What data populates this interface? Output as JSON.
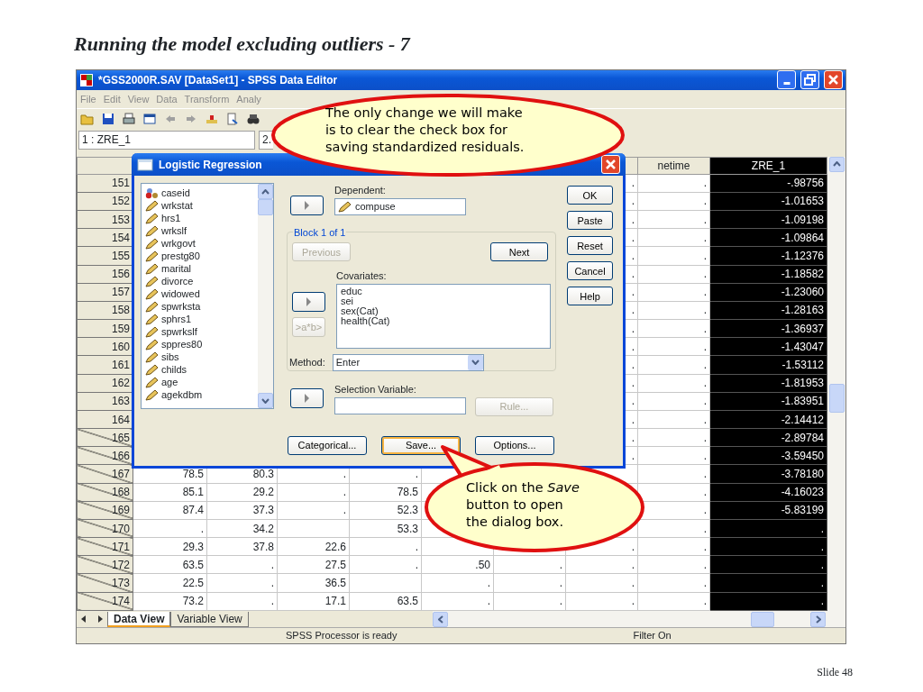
{
  "slide": {
    "title": "Running the model excluding outliers - 7",
    "number": "Slide 48"
  },
  "window": {
    "title": "*GSS2000R.SAV [DataSet1] - SPSS Data Editor"
  },
  "menu": [
    "File",
    "Edit",
    "View",
    "Data",
    "Transform",
    "Analy"
  ],
  "cell_editor": {
    "cell": "1 : ZRE_1",
    "value": "2."
  },
  "grid": {
    "columns": [
      null,
      null,
      null,
      null,
      null,
      null,
      null,
      {
        "name": "netime",
        "selected": false
      },
      {
        "name": "ZRE_1",
        "selected": true
      }
    ],
    "rows": [
      {
        "number": "151",
        "filtered": false,
        "cells": [
          null,
          null,
          null,
          null,
          null,
          null,
          ".",
          ".",
          "-.98756"
        ]
      },
      {
        "number": "152",
        "filtered": false,
        "cells": [
          null,
          null,
          null,
          null,
          null,
          null,
          ".",
          ".",
          "-1.01653"
        ]
      },
      {
        "number": "153",
        "filtered": false,
        "cells": [
          null,
          null,
          null,
          null,
          null,
          null,
          ".",
          ".",
          "-1.09198"
        ]
      },
      {
        "number": "154",
        "filtered": false,
        "cells": [
          null,
          null,
          null,
          null,
          null,
          null,
          ".",
          ".",
          "-1.09864"
        ]
      },
      {
        "number": "155",
        "filtered": false,
        "cells": [
          null,
          null,
          null,
          null,
          null,
          null,
          ".",
          ".",
          "-1.12376"
        ]
      },
      {
        "number": "156",
        "filtered": false,
        "cells": [
          null,
          null,
          null,
          null,
          null,
          null,
          ".",
          ".",
          "-1.18582"
        ]
      },
      {
        "number": "157",
        "filtered": false,
        "cells": [
          null,
          null,
          null,
          null,
          null,
          null,
          ".",
          ".",
          "-1.23060"
        ]
      },
      {
        "number": "158",
        "filtered": false,
        "cells": [
          null,
          null,
          null,
          null,
          null,
          null,
          ".",
          ".",
          "-1.28163"
        ]
      },
      {
        "number": "159",
        "filtered": false,
        "cells": [
          null,
          null,
          null,
          null,
          null,
          null,
          ".",
          ".",
          "-1.36937"
        ]
      },
      {
        "number": "160",
        "filtered": false,
        "cells": [
          null,
          null,
          null,
          null,
          null,
          null,
          ".",
          ".",
          "-1.43047"
        ]
      },
      {
        "number": "161",
        "filtered": false,
        "cells": [
          null,
          null,
          null,
          null,
          null,
          null,
          ".",
          ".",
          "-1.53112"
        ]
      },
      {
        "number": "162",
        "filtered": false,
        "cells": [
          null,
          null,
          null,
          null,
          null,
          null,
          ".",
          ".",
          "-1.81953"
        ]
      },
      {
        "number": "163",
        "filtered": false,
        "cells": [
          null,
          null,
          null,
          null,
          null,
          null,
          ".",
          ".",
          "-1.83951"
        ]
      },
      {
        "number": "164",
        "filtered": false,
        "cells": [
          null,
          null,
          null,
          null,
          null,
          null,
          ".",
          ".",
          "-2.14412"
        ]
      },
      {
        "number": "165",
        "filtered": true,
        "cells": [
          null,
          null,
          null,
          null,
          null,
          null,
          ".",
          ".",
          "-2.89784"
        ]
      },
      {
        "number": "166",
        "filtered": true,
        "cells": [
          null,
          null,
          null,
          null,
          null,
          null,
          ".",
          ".",
          "-3.59450"
        ]
      },
      {
        "number": "167",
        "filtered": true,
        "cells": [
          "78.5",
          "80.3",
          ".",
          ".",
          null,
          null,
          null,
          ".",
          "-3.78180"
        ]
      },
      {
        "number": "168",
        "filtered": true,
        "cells": [
          "85.1",
          "29.2",
          ".",
          "78.5",
          null,
          null,
          null,
          ".",
          "-4.16023"
        ]
      },
      {
        "number": "169",
        "filtered": true,
        "cells": [
          "87.4",
          "37.3",
          ".",
          "52.3",
          null,
          null,
          null,
          ".",
          "-5.83199"
        ]
      },
      {
        "number": "170",
        "filtered": true,
        "cells": [
          ".",
          "34.2",
          null,
          "53.3",
          null,
          null,
          null,
          ".",
          "."
        ]
      },
      {
        "number": "171",
        "filtered": true,
        "cells": [
          "29.3",
          "37.8",
          "22.6",
          ".",
          null,
          null,
          ".",
          ".",
          "."
        ]
      },
      {
        "number": "172",
        "filtered": true,
        "cells": [
          "63.5",
          ".",
          "27.5",
          ".",
          ".50",
          ".",
          ".",
          ".",
          "."
        ]
      },
      {
        "number": "173",
        "filtered": true,
        "cells": [
          "22.5",
          ".",
          "36.5",
          null,
          ".",
          ".",
          ".",
          ".",
          "."
        ]
      },
      {
        "number": "174",
        "filtered": true,
        "cells": [
          "73.2",
          ".",
          "17.1",
          "63.5",
          ".",
          ".",
          ".",
          ".",
          "."
        ]
      }
    ]
  },
  "dialog": {
    "title": "Logistic Regression",
    "variables": [
      {
        "name": "caseid",
        "kind": "nominal"
      },
      {
        "name": "wrkstat",
        "kind": "scale"
      },
      {
        "name": "hrs1",
        "kind": "scale"
      },
      {
        "name": "wrkslf",
        "kind": "scale"
      },
      {
        "name": "wrkgovt",
        "kind": "scale"
      },
      {
        "name": "prestg80",
        "kind": "scale"
      },
      {
        "name": "marital",
        "kind": "scale"
      },
      {
        "name": "divorce",
        "kind": "scale"
      },
      {
        "name": "widowed",
        "kind": "scale"
      },
      {
        "name": "spwrksta",
        "kind": "scale"
      },
      {
        "name": "sphrs1",
        "kind": "scale"
      },
      {
        "name": "spwrkslf",
        "kind": "scale"
      },
      {
        "name": "sppres80",
        "kind": "scale"
      },
      {
        "name": "sibs",
        "kind": "scale"
      },
      {
        "name": "childs",
        "kind": "scale"
      },
      {
        "name": "age",
        "kind": "scale"
      },
      {
        "name": "agekdbm",
        "kind": "scale"
      }
    ],
    "dependent": {
      "label": "Dependent:",
      "value": "compuse"
    },
    "block": {
      "label": "Block 1 of 1",
      "previous": {
        "label": "Previous",
        "disabled": true
      },
      "next": {
        "label": "Next",
        "disabled": false
      }
    },
    "covariates": {
      "label": "Covariates:",
      "items": [
        "educ",
        "sei",
        "sex(Cat)",
        "health(Cat)"
      ]
    },
    "interaction_button": {
      "label": ">a*b>",
      "disabled": true
    },
    "method": {
      "label": "Method:",
      "value": "Enter"
    },
    "selection": {
      "label": "Selection Variable:"
    },
    "rule_button": {
      "label": "Rule...",
      "disabled": true
    },
    "side_buttons": [
      "OK",
      "Paste",
      "Reset",
      "Cancel",
      "Help"
    ],
    "bottom_buttons": [
      {
        "label": "Categorical...",
        "selected": false
      },
      {
        "label": "Save...",
        "selected": true
      },
      {
        "label": "Options...",
        "selected": false
      }
    ]
  },
  "callouts": [
    {
      "text": "The only change we will make is to clear the check box for saving standardized residuals."
    },
    {
      "text": "Click on the *Save* button to open the dialog box."
    }
  ],
  "tabs": [
    {
      "label": "Data View",
      "selected": true
    },
    {
      "label": "Variable View",
      "selected": false
    }
  ],
  "status_bar": [
    "SPSS Processor is ready",
    "Filter On"
  ]
}
